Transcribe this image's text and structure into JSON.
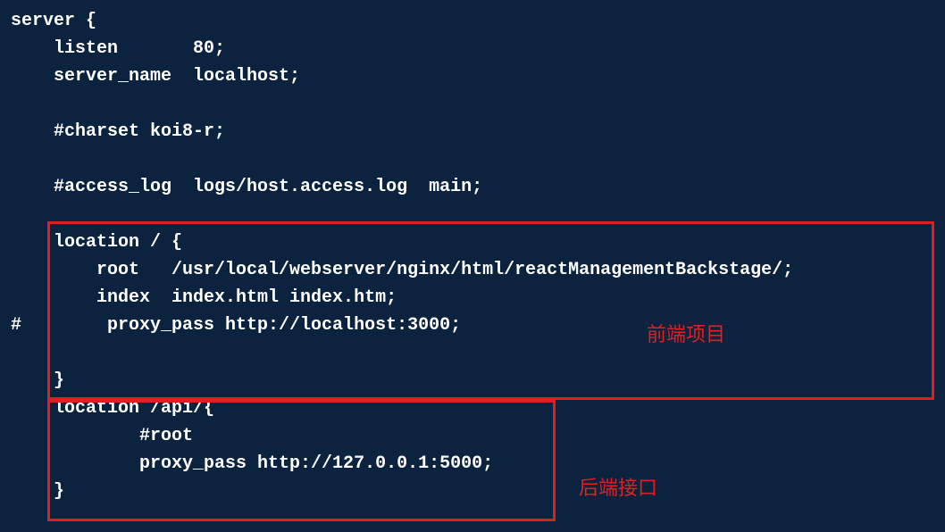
{
  "code_lines": {
    "l1": "server {",
    "l2": "    listen       80;",
    "l3": "    server_name  localhost;",
    "l4": "",
    "l5": "    #charset koi8-r;",
    "l6": "",
    "l7": "    #access_log  logs/host.access.log  main;",
    "l8": "",
    "l9": "    location / {",
    "l10": "        root   /usr/local/webserver/nginx/html/reactManagementBackstage/;",
    "l11": "        index  index.html index.htm;",
    "l12": "#        proxy_pass http://localhost:3000;",
    "l13": "",
    "l14": "    }",
    "l15": "    location /api/{",
    "l16": "            #root",
    "l17": "            proxy_pass http://127.0.0.1:5000;",
    "l18": "    }"
  },
  "labels": {
    "frontend": "前端项目",
    "backend": "后端接口"
  }
}
